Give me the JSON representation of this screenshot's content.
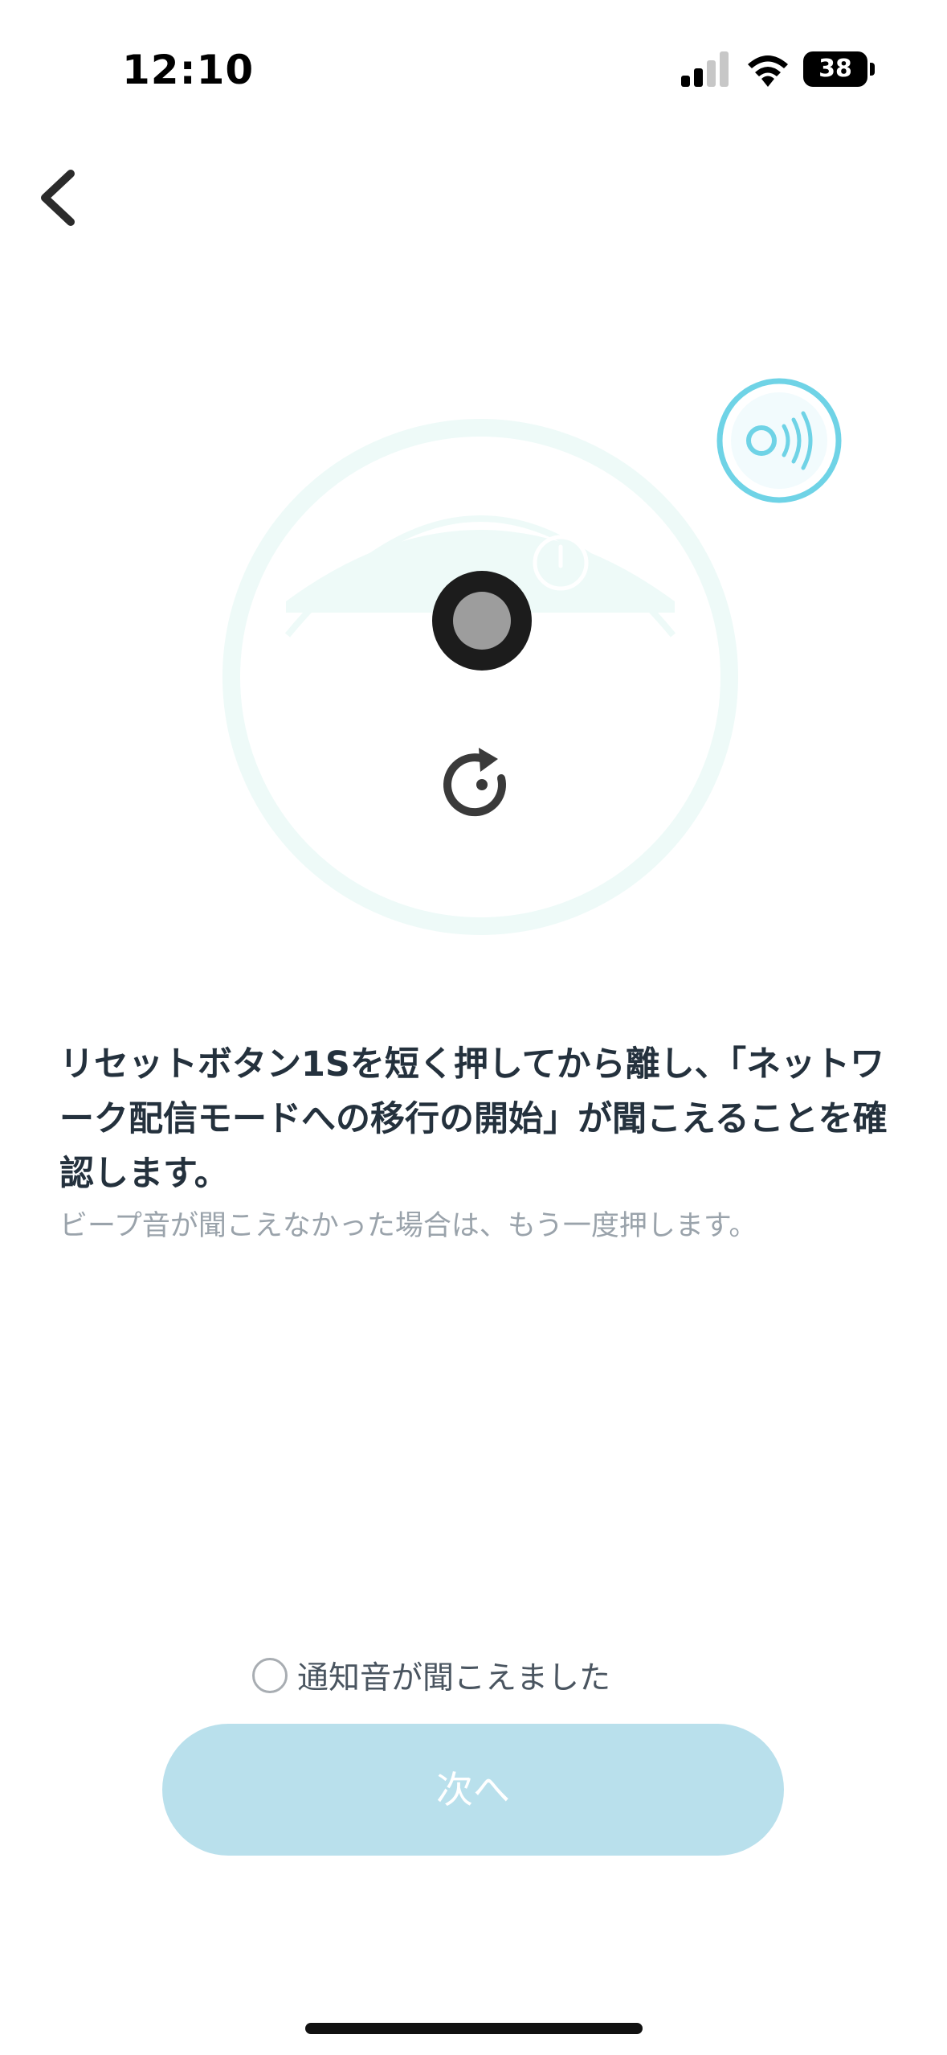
{
  "status_bar": {
    "time": "12:10",
    "battery": "38"
  },
  "main": {
    "instruction": "リセットボタン1Sを短く押してから離し、「ネットワーク配信モードへの移行の開始」が聞こえることを確認します。",
    "hint": "ビープ音が聞こえなかった場合は、もう一度押します。"
  },
  "footer": {
    "confirm_label": "通知音が聞こえました",
    "next_label": "次へ",
    "confirm_checked": false
  },
  "colors": {
    "accent": "#6fd3e6",
    "button_disabled": "#b9e0ec",
    "robot_outline": "#eefaf8",
    "text_primary": "#24313d",
    "text_secondary": "#9aa3ab"
  },
  "icons": [
    "back-chevron-icon",
    "signal-icon",
    "wifi-icon",
    "battery-icon",
    "sound-wave-icon",
    "power-icon",
    "reset-button-icon",
    "rotate-icon",
    "radio-icon"
  ]
}
